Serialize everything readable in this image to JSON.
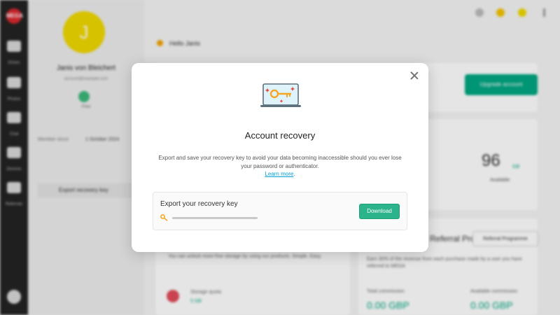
{
  "background": {
    "rail": {
      "logo": "MEGA",
      "items": [
        {
          "label": "Drives",
          "icon": "folder-icon"
        },
        {
          "label": "Photos",
          "icon": "image-icon"
        },
        {
          "label": "Chat",
          "icon": "chat-icon"
        },
        {
          "label": "Devices",
          "icon": "devices-icon"
        },
        {
          "label": "Referrals",
          "icon": "referral-icon"
        }
      ]
    },
    "profile": {
      "initial": "J",
      "name": "Janis von Bleichert",
      "email": "account@example.com",
      "plan": "Free",
      "member_since_label": "Member since",
      "member_since_value": "1 October 2024",
      "recovery_key_item": "Export recovery key"
    },
    "greeting": "Hello Janis",
    "upgrade_button": "Upgrade account",
    "storage": {
      "value": "96",
      "suffix": "GB",
      "available_label": "Available"
    },
    "referral": {
      "title": "Referral Programme",
      "button": "Referral Programme",
      "desc": "Earn 30% of the revenue from each purchase made by a user you have referred to MEGA"
    },
    "achievements": {
      "desc": "You can unlock more free storage by using our products. Simple. Easy.",
      "storage_label": "Storage quota",
      "storage_value": "5 GB"
    },
    "commission": {
      "total_label": "Total commission",
      "total_value": "0.00 GBP",
      "available_label": "Available commission",
      "available_value": "0.00 GBP"
    }
  },
  "modal": {
    "title": "Account recovery",
    "description": "Export and save your recovery key to avoid your data becoming inaccessible should you ever lose your password or authenticator.",
    "learn_more": "Learn more",
    "export_label": "Export your recovery key",
    "download_button": "Download",
    "close_icon": "close-icon",
    "illustration_icon": "laptop-key-icon"
  },
  "colors": {
    "accent": "#2bb38b",
    "link": "#00a0d0",
    "brand": "#d9272e"
  }
}
